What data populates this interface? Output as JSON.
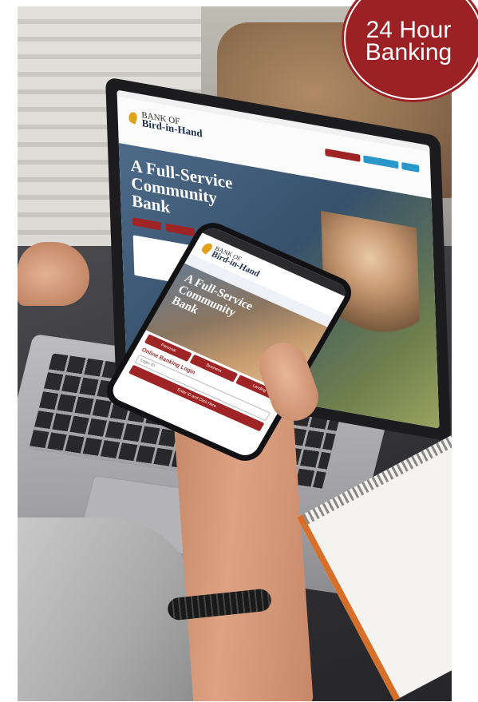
{
  "badge": {
    "line1": "24 Hour",
    "line2": "Banking",
    "color": "#9b2125"
  },
  "laptop_site": {
    "logo_top": "BANK OF",
    "logo_bottom": "Bird-in-Hand",
    "hero_title": "A Full-Service Community Bank"
  },
  "phone_site": {
    "logo_top": "BANK OF",
    "logo_bottom": "Bird-in-Hand",
    "hero_title": "A Full-Service Community Bank",
    "tabs": [
      "Personal",
      "Business",
      "Lending"
    ],
    "login_title": "Online Banking Login",
    "login_field_placeholder": "Login ID",
    "submit_label": "Enter ID and Click Here"
  },
  "colors": {
    "brand_red": "#9f2426",
    "brand_navy": "#1e2d4a",
    "brand_gold": "#e0a11b"
  }
}
